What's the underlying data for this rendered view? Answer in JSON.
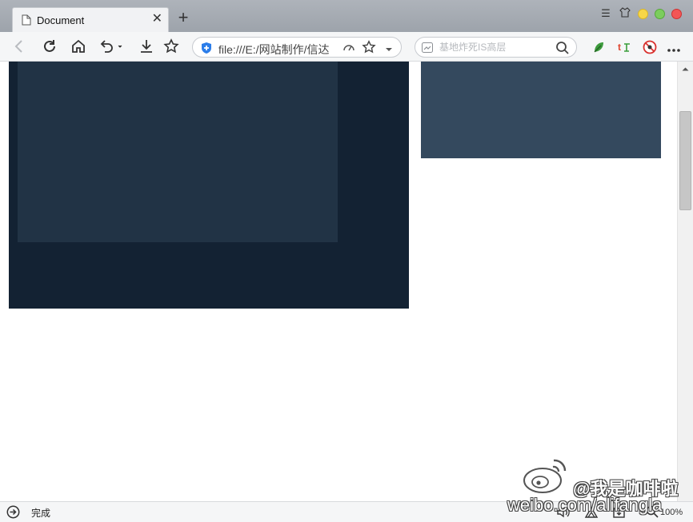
{
  "tab": {
    "title": "Document",
    "close_glyph": "✕",
    "icon": "document-icon"
  },
  "new_tab_glyph": "+",
  "window_controls": {
    "menu_glyph": "☰",
    "skin_glyph": "👕"
  },
  "toolbar": {
    "back": "back-icon",
    "refresh": "refresh-icon",
    "home": "home-icon",
    "undo": "undo-icon",
    "download": "download-icon",
    "favorites": "star-icon"
  },
  "address": {
    "url": "file:///E:/网站制作/信达"
  },
  "search": {
    "placeholder": "基地炸死IS高层"
  },
  "status": {
    "text": "完成",
    "zoom": "100%"
  },
  "watermark": {
    "handle": "@我是咖啡啦",
    "url": "weibo.com/alifangla"
  },
  "colors": {
    "box_outer": "#132233",
    "box_inner": "#213345",
    "box_right": "#34495e",
    "titlebar": "#9da3ab",
    "toolbar": "#f5f6f7"
  }
}
